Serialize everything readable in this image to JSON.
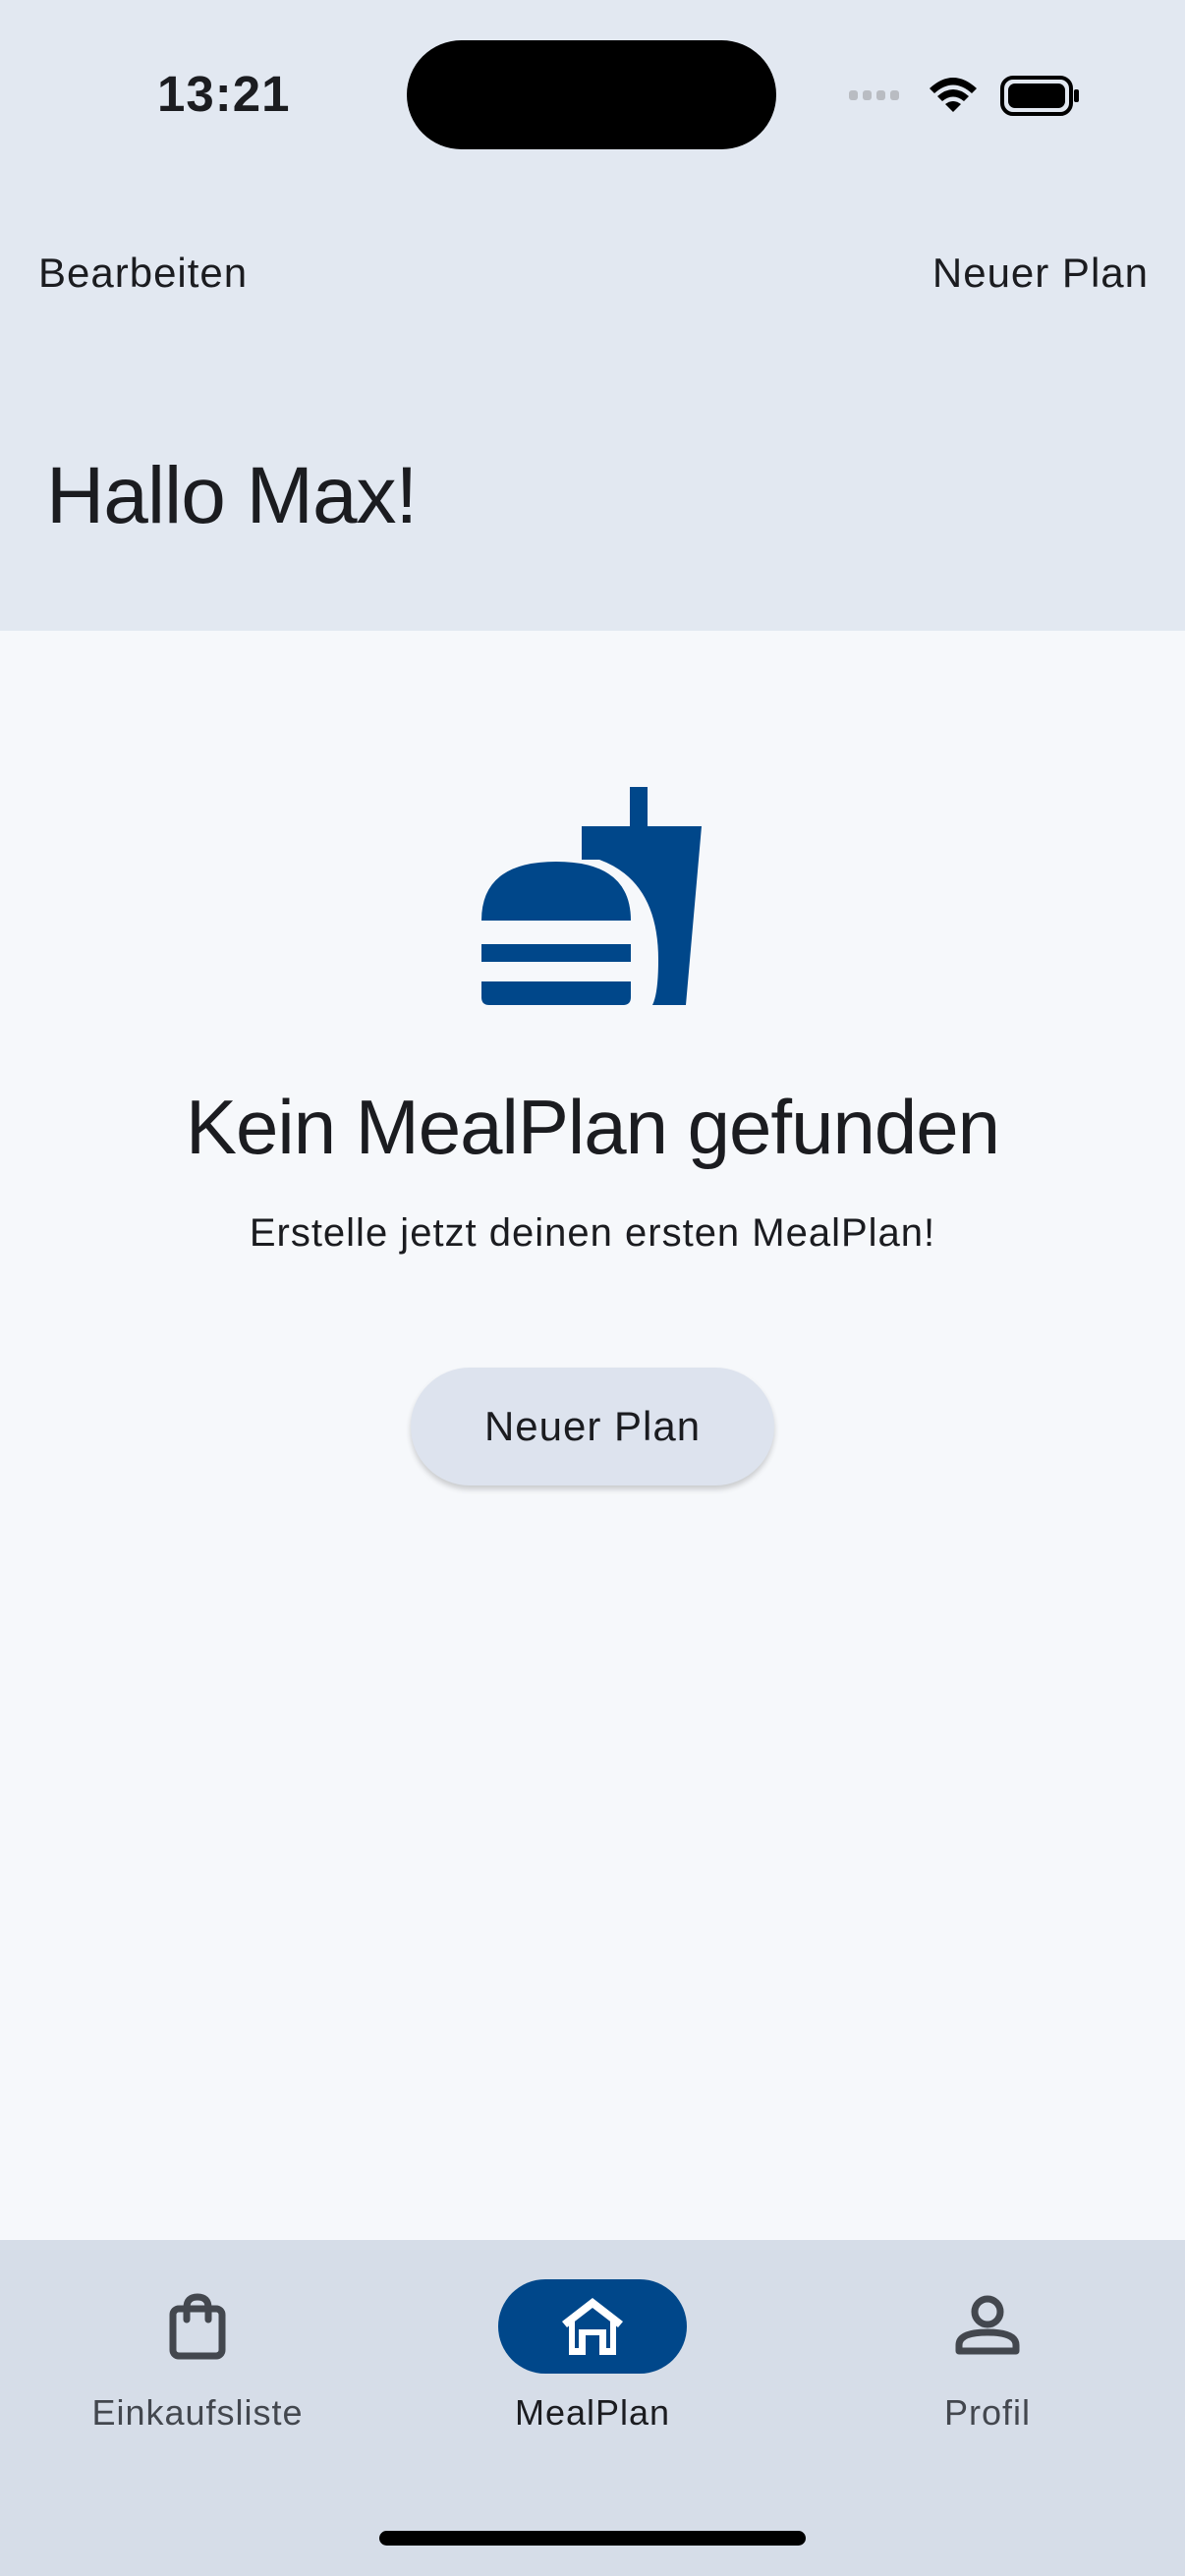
{
  "status_bar": {
    "time": "13:21"
  },
  "nav": {
    "edit_label": "Bearbeiten",
    "new_plan_label": "Neuer Plan"
  },
  "greeting": "Hallo Max!",
  "empty_state": {
    "icon": "fastfood-icon",
    "title": "Kein MealPlan gefunden",
    "subtitle": "Erstelle jetzt deinen ersten MealPlan!",
    "button_label": "Neuer Plan"
  },
  "bottom_nav": {
    "tabs": [
      {
        "label": "Einkaufsliste",
        "icon": "shopping-bag-icon",
        "active": false
      },
      {
        "label": "MealPlan",
        "icon": "home-icon",
        "active": true
      },
      {
        "label": "Profil",
        "icon": "person-icon",
        "active": false
      }
    ]
  },
  "colors": {
    "accent": "#00478A",
    "header_bg": "#E2E8F1",
    "content_bg": "#F6F8FB",
    "nav_bg": "#D6DDE8",
    "button_bg": "#DDE3EE"
  }
}
